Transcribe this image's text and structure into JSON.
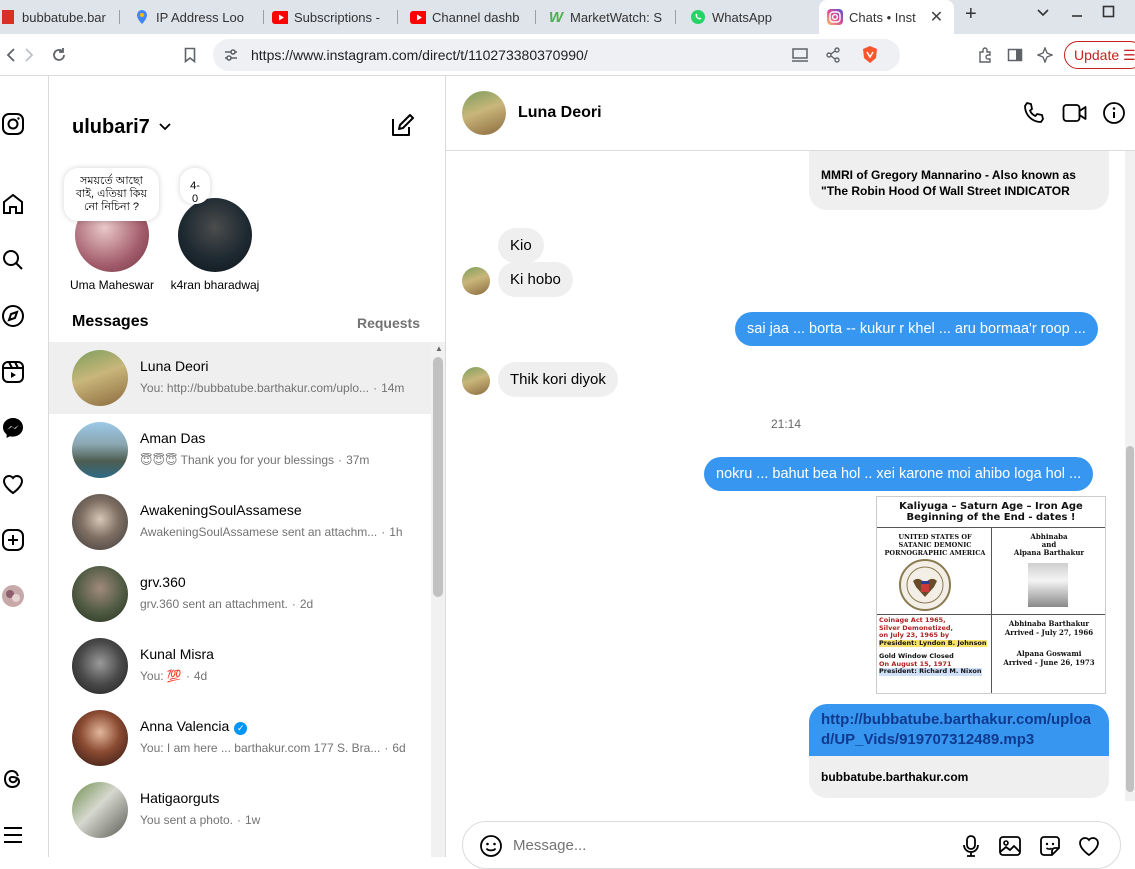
{
  "browser": {
    "tabs": [
      {
        "label": "bubbatube.bar",
        "fav_color": "#d93025"
      },
      {
        "label": "IP Address Loo",
        "fav_color": "#4285f4"
      },
      {
        "label": "Subscriptions -",
        "fav_color": "#ff0000"
      },
      {
        "label": "Channel dashb",
        "fav_color": "#ff0000"
      },
      {
        "label": "MarketWatch: S",
        "fav_color": "#4caf50"
      },
      {
        "label": "WhatsApp",
        "fav_color": "#25d366"
      }
    ],
    "active_tab": {
      "label": "Chats • Inst",
      "close": "✕"
    },
    "new_tab": "+",
    "url": "https://www.instagram.com/direct/t/110273380370990/",
    "update_label": "Update"
  },
  "inbox": {
    "username": "ulubari7",
    "stories": [
      {
        "name": "Uma Maheswar",
        "note": "সময়ৰ্তে আছো বাই, এতিয়া কিয় নো নিচিনা ?"
      },
      {
        "name": "k4ran bharadwaj",
        "note": "4-0"
      }
    ],
    "messages_heading": "Messages",
    "requests_label": "Requests",
    "conversations": [
      {
        "name": "Luna Deori",
        "preview": "You: http://bubbatube.barthakur.com/uplo...",
        "time": "14m",
        "selected": true
      },
      {
        "name": "Aman Das",
        "preview": "😇😇😇 Thank you for your blessings",
        "time": "37m"
      },
      {
        "name": "AwakeningSoulAssamese",
        "preview": "AwakeningSoulAssamese sent an attachm...",
        "time": "1h"
      },
      {
        "name": "grv.360",
        "preview": "grv.360 sent an attachment.",
        "time": "2d"
      },
      {
        "name": "Kunal Misra",
        "preview": "You: 💯",
        "time": "4d"
      },
      {
        "name": "Anna Valencia",
        "preview": "You: I am here ... barthakur.com 177 S. Bra...",
        "time": "6d",
        "verified": true
      },
      {
        "name": "Hatigaorguts",
        "preview": "You sent a photo.",
        "time": "1w"
      }
    ]
  },
  "chat": {
    "contact_name": "Luna Deori",
    "card_text": "MMRI of Gregory Mannarino - Also known as \"The Robin Hood Of Wall Street INDICATOR",
    "messages": [
      {
        "from": "them",
        "text": "Kio"
      },
      {
        "from": "them",
        "text": "Ki hobo"
      },
      {
        "from": "me",
        "text": "sai jaa ... borta -- kukur r khel ... aru bormaa'r roop ..."
      },
      {
        "from": "them",
        "text": "Thik kori diyok"
      },
      {
        "from": "me",
        "text": "nokru ... bahut bea hol  .. xei karone moi ahibo loga hol ..."
      }
    ],
    "timestamp": "21:14",
    "poster": {
      "title1": "Kaliyuga – Saturn Age – Iron Age",
      "title2": "Beginning of the End - dates !",
      "left_head": "UNITED STATES OF SATANIC DEMONIC PORNOGRAPHIC AMERICA",
      "right_head1": "Abhinaba",
      "right_head2": "and",
      "right_head3": "Alpana Barthakur",
      "coinage1": "Coinage Act 1965,",
      "coinage2": "Silver Demonetized,",
      "coinage3": "on July 23, 1965 by",
      "coinage4": "President: Lyndon B. Johnson",
      "gold1": "Gold Window Closed",
      "gold2": "On August 15, 1971",
      "gold3": "President: Richard M. Nixon",
      "abhi1": "Abhinaba Barthakur",
      "abhi2": "Arrived - July 27, 1966",
      "alp1": "Alpana Goswami",
      "alp2": "Arrived - June 26, 1973"
    },
    "link": {
      "url": "http://bubbatube.barthakur.com/upload/UP_Vids/919707312489.mp3",
      "domain": "bubbatube.barthakur.com"
    },
    "composer_placeholder": "Message..."
  }
}
